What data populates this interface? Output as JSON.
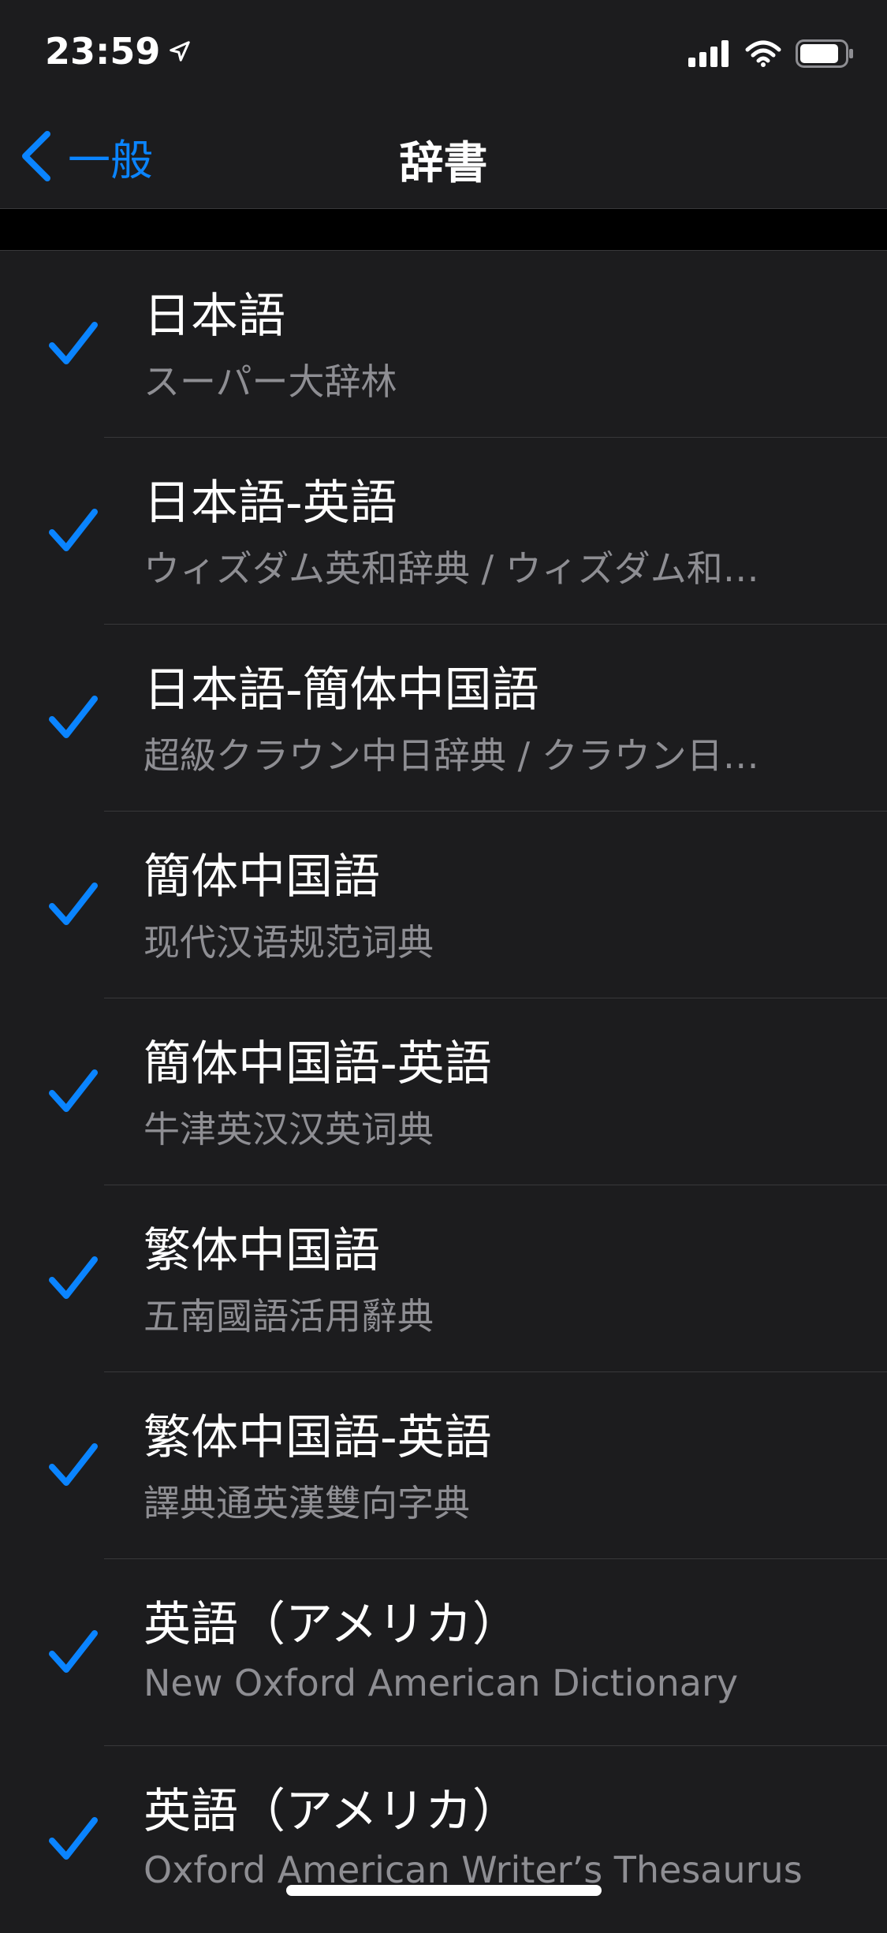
{
  "status_bar": {
    "time": "23:59"
  },
  "nav": {
    "back_label": "一般",
    "title": "辞書"
  },
  "colors": {
    "accent": "#0a84ff",
    "background": "#1c1c1e",
    "secondary_text": "#8e8e93"
  },
  "dictionaries": [
    {
      "title": "日本語",
      "subtitle": "スーパー大辞林",
      "checked": true
    },
    {
      "title": "日本語-英語",
      "subtitle": "ウィズダム英和辞典 / ウィズダム和…",
      "checked": true
    },
    {
      "title": "日本語-簡体中国語",
      "subtitle": "超級クラウン中日辞典 / クラウン日…",
      "checked": true
    },
    {
      "title": "簡体中国語",
      "subtitle": "现代汉语规范词典",
      "checked": true
    },
    {
      "title": "簡体中国語-英語",
      "subtitle": "牛津英汉汉英词典",
      "checked": true
    },
    {
      "title": "繁体中国語",
      "subtitle": "五南國語活用辭典",
      "checked": true
    },
    {
      "title": "繁体中国語-英語",
      "subtitle": "譯典通英漢雙向字典",
      "checked": true
    },
    {
      "title": "英語（アメリカ）",
      "subtitle": "New Oxford American Dictionary",
      "checked": true
    },
    {
      "title": "英語（アメリカ）",
      "subtitle": "Oxford American Writer’s Thesaurus",
      "checked": true
    }
  ]
}
